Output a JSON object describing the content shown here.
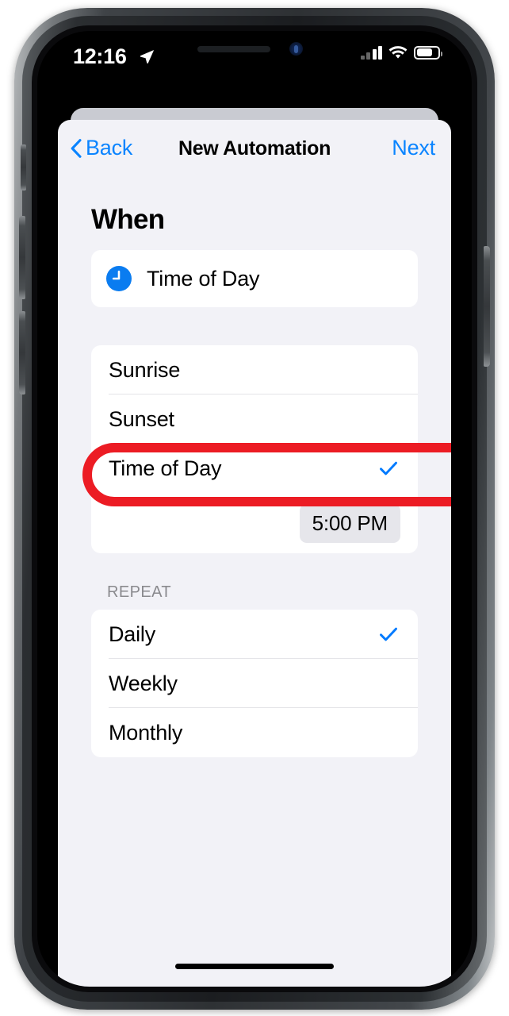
{
  "status_bar": {
    "time": "12:16",
    "location_icon": "location-arrow-icon",
    "cellular_icon": "cellular-signal-icon",
    "cellular_bars_filled": 2,
    "cellular_bars_total": 4,
    "wifi_icon": "wifi-icon",
    "battery_icon": "battery-icon",
    "battery_level_percent": 68
  },
  "nav": {
    "back_label": "Back",
    "title": "New Automation",
    "next_label": "Next"
  },
  "main": {
    "section_heading": "When",
    "trigger_card": {
      "icon": "clock-icon",
      "label": "Time of Day"
    },
    "trigger_options": [
      {
        "label": "Sunrise",
        "selected": false
      },
      {
        "label": "Sunset",
        "selected": false
      },
      {
        "label": "Time of Day",
        "selected": true
      }
    ],
    "time_value": "5:00 PM",
    "repeat_label": "REPEAT",
    "repeat_options": [
      {
        "label": "Daily",
        "selected": true
      },
      {
        "label": "Weekly",
        "selected": false
      },
      {
        "label": "Monthly",
        "selected": false
      }
    ]
  },
  "annotation": {
    "shape": "oval-highlight",
    "target": "Time of Day",
    "color": "#ec1c24"
  },
  "colors": {
    "accent_blue": "#0a84ff",
    "check_blue": "#007aff",
    "background_gray": "#f2f2f7",
    "card_white": "#ffffff",
    "pill_gray": "#e6e6eb",
    "annotation_red": "#ec1c24"
  }
}
